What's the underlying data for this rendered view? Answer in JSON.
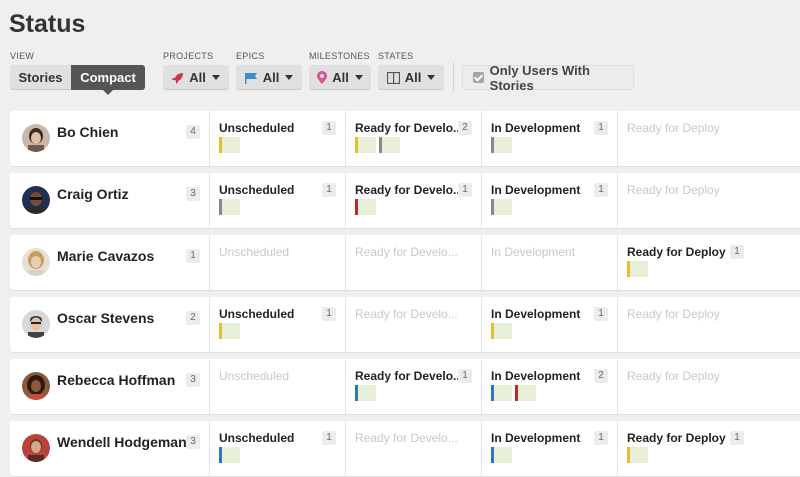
{
  "page": {
    "title": "Status"
  },
  "filters": {
    "view": {
      "label": "VIEW",
      "options": [
        "Stories",
        "Compact"
      ],
      "selected": "Compact"
    },
    "projects": {
      "label": "PROJECTS",
      "value": "All",
      "icon": "rocket-icon"
    },
    "epics": {
      "label": "EPICS",
      "value": "All",
      "icon": "flag-icon"
    },
    "milestones": {
      "label": "MILESTONES",
      "value": "All",
      "icon": "map-pin-icon"
    },
    "states": {
      "label": "STATES",
      "value": "All",
      "icon": "columns-icon"
    },
    "only_users": {
      "label": "Only Users With Stories",
      "checked": true
    }
  },
  "colors": {
    "yellow": "#e3c02b",
    "gray": "#8a8a86",
    "red": "#c0262d",
    "blue": "#2a7ab8",
    "card_bg": "#e7efd9"
  },
  "users": [
    {
      "name": "Bo Chien",
      "count": "4",
      "columns": [
        {
          "label": "Unscheduled",
          "count": "1",
          "cards": [
            "yellow"
          ]
        },
        {
          "label": "Ready for Develo...",
          "count": "2",
          "cards": [
            "yellow",
            "gray"
          ]
        },
        {
          "label": "In Development",
          "count": "1",
          "cards": [
            "gray"
          ]
        },
        {
          "label": "Ready for Deploy",
          "count": "",
          "cards": []
        }
      ]
    },
    {
      "name": "Craig Ortiz",
      "count": "3",
      "columns": [
        {
          "label": "Unscheduled",
          "count": "1",
          "cards": [
            "gray"
          ]
        },
        {
          "label": "Ready for Develo...",
          "count": "1",
          "cards": [
            "red"
          ]
        },
        {
          "label": "In Development",
          "count": "1",
          "cards": [
            "gray"
          ]
        },
        {
          "label": "Ready for Deploy",
          "count": "",
          "cards": []
        }
      ]
    },
    {
      "name": "Marie Cavazos",
      "count": "1",
      "columns": [
        {
          "label": "Unscheduled",
          "count": "",
          "cards": []
        },
        {
          "label": "Ready for Develo...",
          "count": "",
          "cards": []
        },
        {
          "label": "In Development",
          "count": "",
          "cards": []
        },
        {
          "label": "Ready for Deploy",
          "count": "1",
          "cards": [
            "yellow"
          ]
        }
      ]
    },
    {
      "name": "Oscar Stevens",
      "count": "2",
      "columns": [
        {
          "label": "Unscheduled",
          "count": "1",
          "cards": [
            "yellow"
          ]
        },
        {
          "label": "Ready for Develo...",
          "count": "",
          "cards": []
        },
        {
          "label": "In Development",
          "count": "1",
          "cards": [
            "yellow"
          ]
        },
        {
          "label": "Ready for Deploy",
          "count": "",
          "cards": []
        }
      ]
    },
    {
      "name": "Rebecca Hoffman",
      "count": "3",
      "columns": [
        {
          "label": "Unscheduled",
          "count": "",
          "cards": []
        },
        {
          "label": "Ready for Develo...",
          "count": "1",
          "cards": [
            "blue"
          ]
        },
        {
          "label": "In Development",
          "count": "2",
          "cards": [
            "blue",
            "red"
          ]
        },
        {
          "label": "Ready for Deploy",
          "count": "",
          "cards": []
        }
      ]
    },
    {
      "name": "Wendell Hodgeman",
      "count": "3",
      "columns": [
        {
          "label": "Unscheduled",
          "count": "1",
          "cards": [
            "blue"
          ]
        },
        {
          "label": "Ready for Develo...",
          "count": "",
          "cards": []
        },
        {
          "label": "In Development",
          "count": "1",
          "cards": [
            "blue"
          ]
        },
        {
          "label": "Ready for Deploy",
          "count": "1",
          "cards": [
            "yellow"
          ]
        }
      ]
    }
  ]
}
